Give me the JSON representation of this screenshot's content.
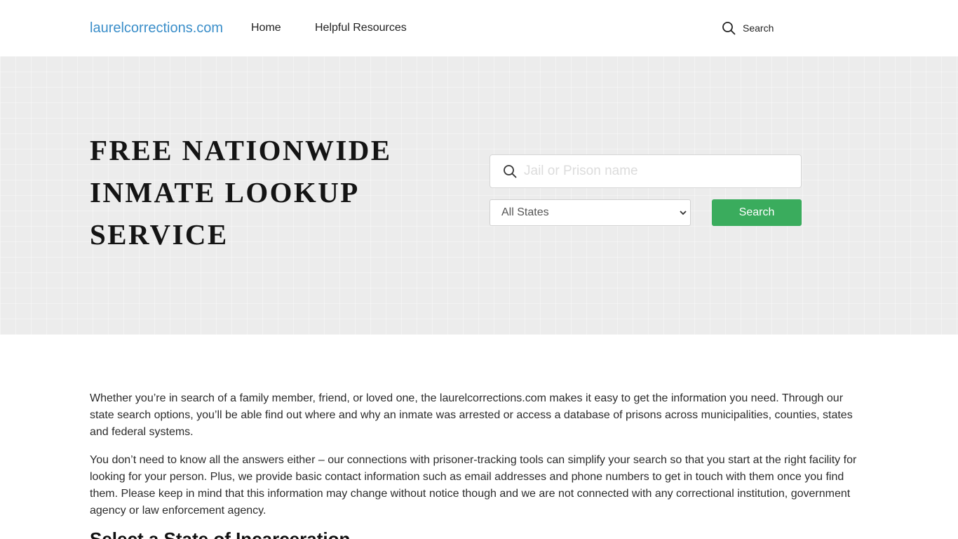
{
  "header": {
    "logo": "laurelcorrections.com",
    "nav": [
      {
        "label": "Home"
      },
      {
        "label": "Helpful Resources"
      }
    ],
    "search_label": "Search"
  },
  "hero": {
    "title_lines": [
      "FREE NATIONWIDE",
      "INMATE LOOKUP",
      "SERVICE"
    ],
    "search_placeholder": "Jail or Prison name",
    "state_selected": "All States",
    "search_button": "Search"
  },
  "content": {
    "paragraphs": [
      "Whether you’re in search of a family member, friend, or loved one, the laurelcorrections.com makes it easy to get the information you need. Through our state search options, you’ll be able find out where and why an inmate was arrested or access a database of prisons across municipalities, counties, states and federal systems.",
      "You don’t need to know all the answers either – our connections with prisoner-tracking tools can simplify your search so that you start at the right facility for looking for your person. Plus, we provide basic contact information such as email addresses and phone numbers to get in touch with them once you find them. Please keep in mind that this information may change without notice though and we are not connected with any correctional institution, government agency or law enforcement agency."
    ],
    "section_heading": "Select a State of Incarceration"
  },
  "colors": {
    "logo": "#3a8ec9",
    "button": "#3aac5d",
    "hero_bg": "#ececec"
  },
  "icons": {
    "header_search": "search-icon",
    "input_search": "search-icon",
    "select": "chevron-down-icon"
  }
}
